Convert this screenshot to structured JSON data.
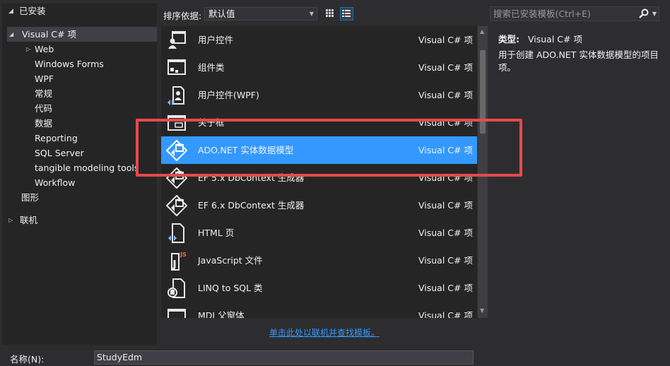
{
  "tree": {
    "root_label": "已安装",
    "items": [
      {
        "label": "Visual C# 项"
      },
      {
        "label": "Web"
      },
      {
        "label": "Windows Forms"
      },
      {
        "label": "WPF"
      },
      {
        "label": "常规"
      },
      {
        "label": "代码"
      },
      {
        "label": "数据"
      },
      {
        "label": "Reporting"
      },
      {
        "label": "SQL Server"
      },
      {
        "label": "tangible modeling tools"
      },
      {
        "label": "Workflow"
      },
      {
        "label": "图形"
      },
      {
        "label": "联机"
      }
    ]
  },
  "toolbar": {
    "sort_label": "排序依据:",
    "sort_value": "默认值",
    "grid_view_icon": "grid-view-icon",
    "list_view_icon": "list-view-icon"
  },
  "search": {
    "placeholder": "搜索已安装模板(Ctrl+E)"
  },
  "templates": [
    {
      "name": "用户控件",
      "lang": "Visual C# 项",
      "icon": "user-control-icon"
    },
    {
      "name": "组件类",
      "lang": "Visual C# 项",
      "icon": "component-class-icon"
    },
    {
      "name": "用户控件(WPF)",
      "lang": "Visual C# 项",
      "icon": "wpf-user-control-icon"
    },
    {
      "name": "关于框",
      "lang": "Visual C# 项",
      "icon": "about-box-icon"
    },
    {
      "name": "ADO.NET 实体数据模型",
      "lang": "Visual C# 项",
      "icon": "entity-data-model-icon"
    },
    {
      "name": "EF 5.x DbContext 生成器",
      "lang": "Visual C# 项",
      "icon": "dbcontext-generator-icon"
    },
    {
      "name": "EF 6.x DbContext 生成器",
      "lang": "Visual C# 项",
      "icon": "dbcontext-generator-icon"
    },
    {
      "name": "HTML 页",
      "lang": "Visual C# 项",
      "icon": "html-page-icon"
    },
    {
      "name": "JavaScript 文件",
      "lang": "Visual C# 项",
      "icon": "javascript-file-icon"
    },
    {
      "name": "LINQ to SQL 类",
      "lang": "Visual C# 项",
      "icon": "linq-to-sql-icon"
    },
    {
      "name": "MDI 父窗体",
      "lang": "Visual C# 项",
      "icon": "mdi-parent-form-icon"
    }
  ],
  "details": {
    "type_label": "类型:",
    "type_value": "Visual C# 项",
    "description": "用于创建 ADO.NET 实体数据模型的项目项。"
  },
  "online_link": "单击此处以联机并查找模板。",
  "name_field": {
    "label": "名称(N):",
    "value": "StudyEdm"
  },
  "colors": {
    "accent": "#3399ff",
    "highlight": "#e8484c",
    "background": "#2d2d30"
  }
}
